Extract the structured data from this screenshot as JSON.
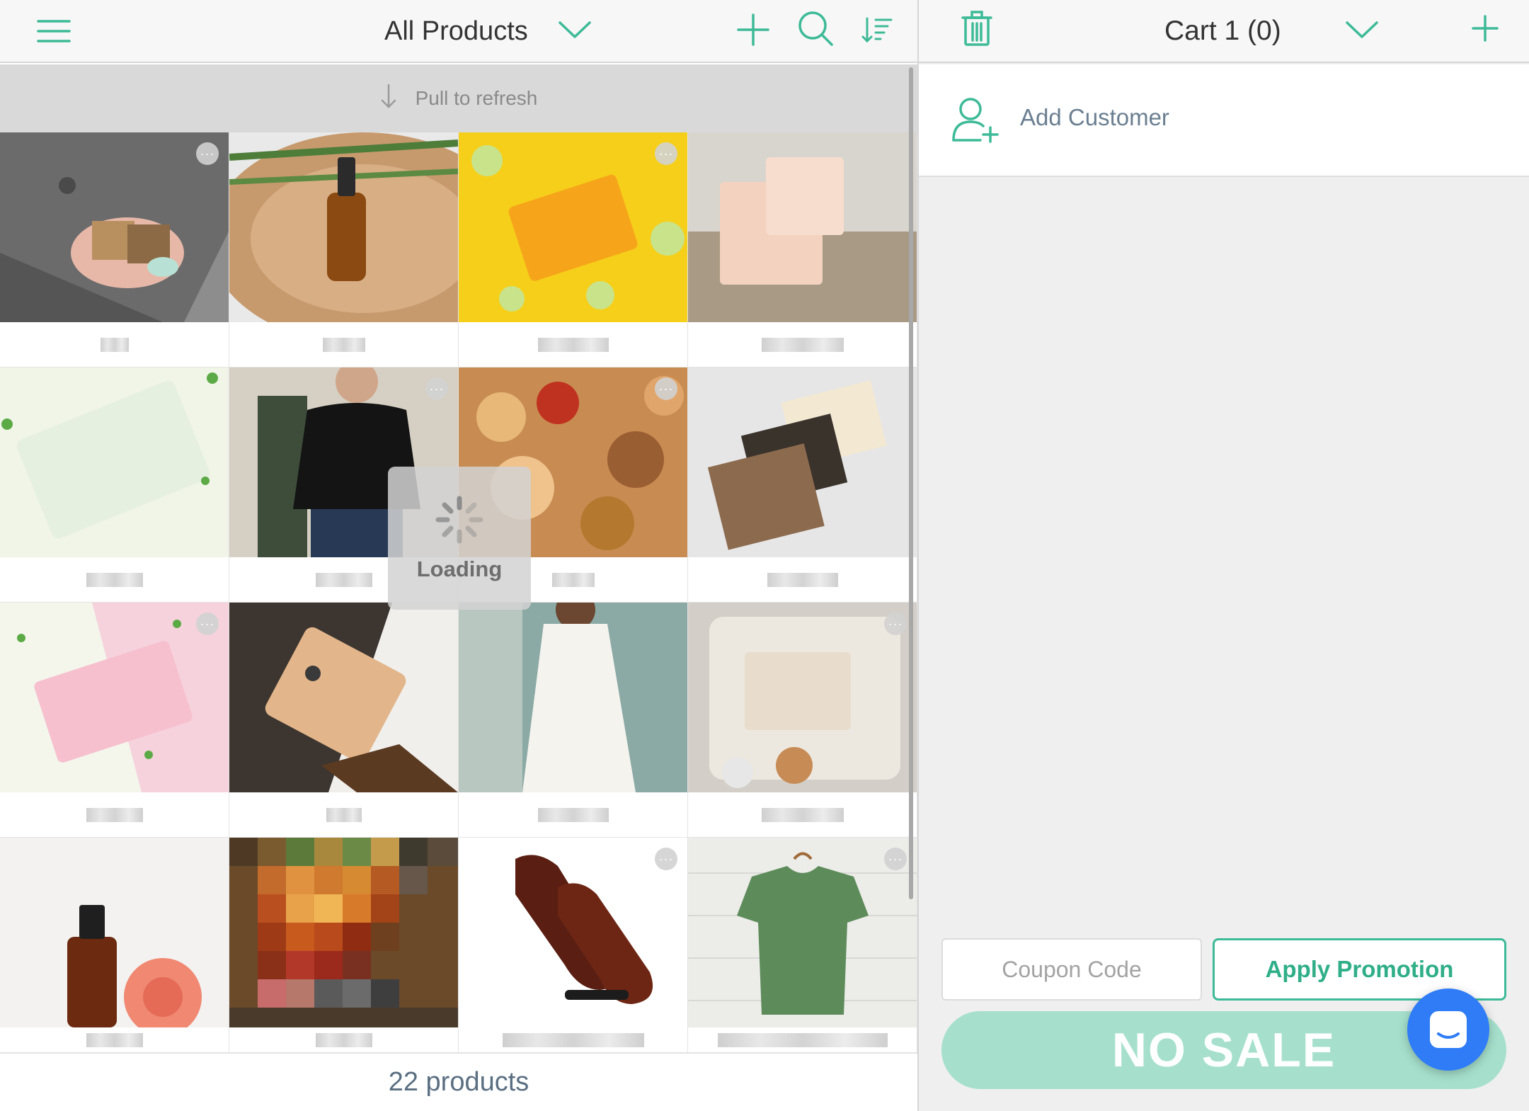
{
  "products_header": {
    "title": "All Products",
    "icons": {
      "menu": "hamburger-menu-icon",
      "dropdown": "chevron-down-icon",
      "add": "plus-icon",
      "search": "search-icon",
      "sort": "sort-icon"
    }
  },
  "refresh": {
    "label": "Pull to refresh",
    "icon": "arrow-down-icon"
  },
  "products": [
    {
      "image": "soap-dish-on-slate",
      "has_more": true
    },
    {
      "image": "dropper-bottle-on-wood",
      "has_more": false
    },
    {
      "image": "yellow-soap-with-limes",
      "has_more": true
    },
    {
      "image": "peach-soap-on-net",
      "has_more": false
    },
    {
      "image": "white-soap-bar",
      "has_more": false
    },
    {
      "image": "black-tshirt-model",
      "has_more": true
    },
    {
      "image": "pastries-and-cookies",
      "has_more": true
    },
    {
      "image": "stacked-handmade-soaps",
      "has_more": false
    },
    {
      "image": "pink-soap-bar",
      "has_more": true
    },
    {
      "image": "hand-holding-leather-wallet",
      "has_more": false
    },
    {
      "image": "floral-dress",
      "has_more": false
    },
    {
      "image": "cream-soap-on-towel",
      "has_more": true
    },
    {
      "image": "amber-bottle-with-rose",
      "has_more": false
    },
    {
      "image": "pixelated-food",
      "has_more": false
    },
    {
      "image": "brown-leather-shoes",
      "has_more": true
    },
    {
      "image": "green-tshirt-on-hanger",
      "has_more": true
    }
  ],
  "loading": {
    "label": "Loading"
  },
  "footer": {
    "count_label": "22 products"
  },
  "cart": {
    "title": "Cart 1 (0)",
    "icons": {
      "trash": "trash-icon",
      "dropdown": "chevron-down-icon",
      "add": "plus-icon"
    },
    "add_customer_label": "Add Customer",
    "coupon_placeholder": "Coupon Code",
    "apply_label": "Apply Promotion",
    "no_sale_label": "NO SALE"
  },
  "colors": {
    "accent": "#3dba97",
    "no_sale_bg": "#a6e0cd",
    "chat_fab": "#2f7cf6"
  }
}
